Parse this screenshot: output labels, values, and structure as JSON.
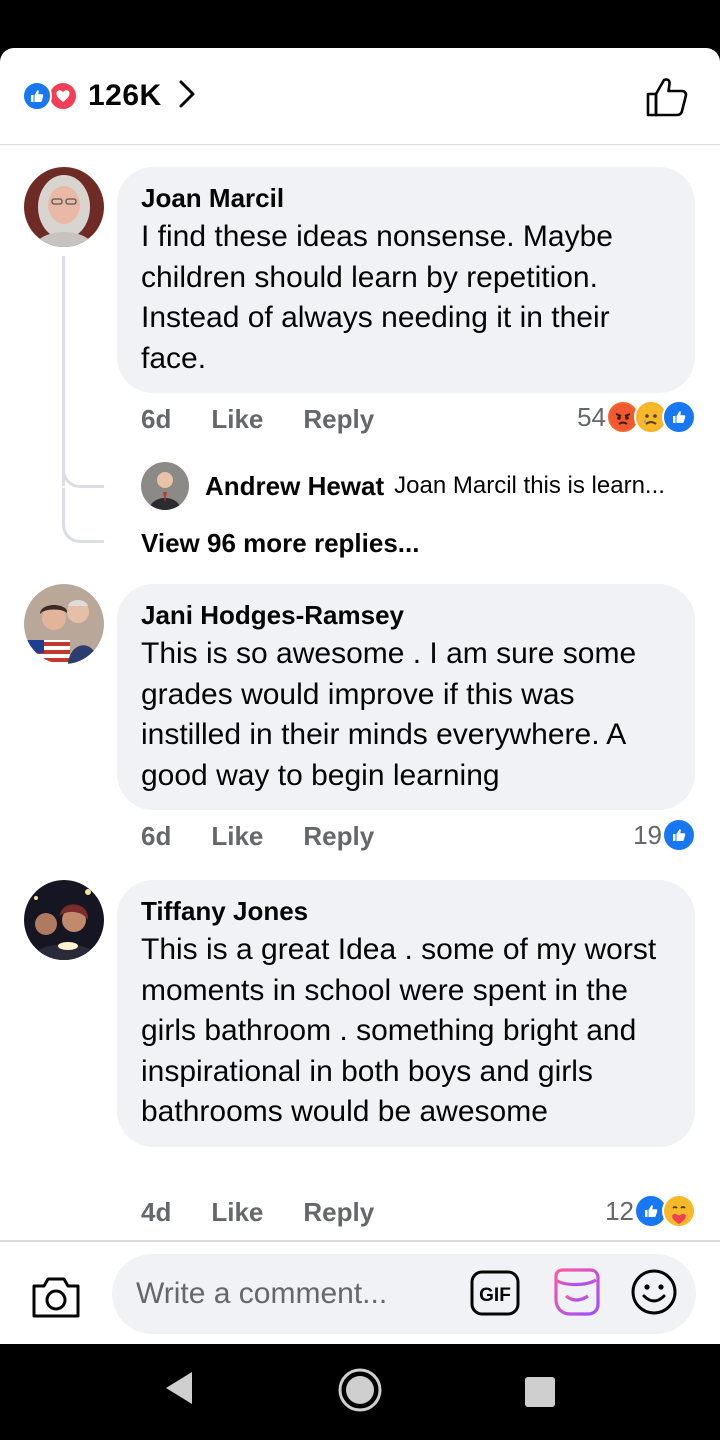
{
  "header": {
    "reaction_count": "126K",
    "reactions": [
      "like-icon",
      "love-icon"
    ]
  },
  "comments": [
    {
      "name": "Joan Marcil",
      "text": "I find these ideas nonsense. Maybe children should learn by repetition. Instead of always needing it in their face.",
      "time": "6d",
      "like_label": "Like",
      "reply_label": "Reply",
      "reaction_count": "54",
      "reactions": [
        "angry-icon",
        "sad-icon",
        "like-icon"
      ],
      "replies": {
        "top_reply_name": "Andrew Hewat",
        "top_reply_text": "Joan Marcil this is learn...",
        "view_more": "View 96 more replies..."
      }
    },
    {
      "name": "Jani Hodges-Ramsey",
      "text": "This is so awesome . I am sure some grades would improve if this was instilled in their minds everywhere.  A good way to begin learning",
      "time": "6d",
      "like_label": "Like",
      "reply_label": "Reply",
      "reaction_count": "19",
      "reactions": [
        "like-icon"
      ]
    },
    {
      "name": "Tiffany Jones",
      "text": "This is a great Idea . some of my worst moments in school were spent in the girls bathroom . something bright and inspirational in both boys and girls bathrooms would be awesome",
      "time": "4d",
      "like_label": "Like",
      "reply_label": "Reply",
      "reaction_count": "12",
      "reactions": [
        "like-icon",
        "care-icon"
      ]
    }
  ],
  "composer": {
    "placeholder": "Write a comment...",
    "value": "",
    "gif_label": "GIF"
  },
  "colors": {
    "facebook_blue": "#1877f2",
    "love_red": "#f33e58",
    "bubble_gray": "#f0f2f5",
    "meta_gray": "#65676b"
  }
}
